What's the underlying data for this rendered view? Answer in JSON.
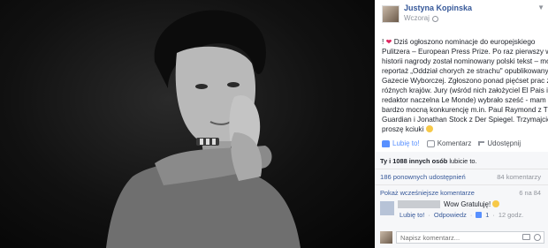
{
  "post": {
    "author": "Justyna Kopinska",
    "timestamp": "Wczoraj",
    "text_lines": [
      "Dziś ogłoszono nominacje do europejskiego",
      "Pulitzera – European Press Prize. Po raz pierwszy w",
      "historii nagrody został nominowany polski tekst – mój",
      "reportaż „Oddział chorych ze strachu\" opublikowany w",
      "Gazecie Wyborczej. Zgłoszono ponad pięćset prac z",
      "różnych krajów. Jury (wśród nich założyciel El Pais i",
      "redaktor naczelna Le Monde) wybrało sześć - mam",
      "bardzo mocną konkurencję m.in. Paul Raymond z The",
      "Guardian i Jonathan Stock z Der Spiegel. Trzymajcie",
      "proszę kciuki"
    ],
    "prefix": "!"
  },
  "actions": {
    "like": "Lubię to!",
    "comment": "Komentarz",
    "share": "Udostępnij"
  },
  "stats": {
    "likes_prefix": "Ty i",
    "likes_count": "1088 innych osób",
    "likes_suffix": "lubicie to.",
    "shares": "186 ponownych udostępnień",
    "comments": "84 komentarzy"
  },
  "comments": {
    "prev_label": "Pokaż wcześniejsze komentarze",
    "prev_count": "6 na 84",
    "items": [
      {
        "text": "Wow  Gratuluję!",
        "like_label": "Lubię to!",
        "reply_label": "Odpowiedz",
        "like_count": "1",
        "time": "12 godz."
      }
    ]
  },
  "composer": {
    "placeholder": "Napisz komentarz..."
  },
  "colors": {
    "link": "#365899",
    "like_active": "#5890ff",
    "muted": "#90949c",
    "heart": "#e0245e"
  },
  "icons": [
    "heart-icon",
    "smile-emoji-icon",
    "like-thumb-icon",
    "comment-icon",
    "share-icon",
    "globe-icon",
    "chevron-down-icon",
    "camera-icon",
    "emoji-icon"
  ]
}
